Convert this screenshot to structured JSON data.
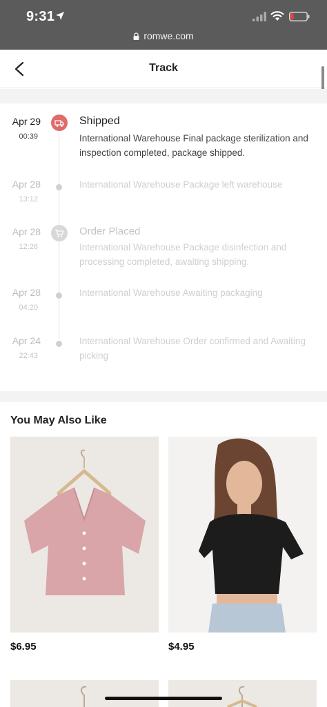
{
  "status_bar": {
    "time": "9:31",
    "url": "romwe.com"
  },
  "header": {
    "title": "Track"
  },
  "timeline": [
    {
      "date": "Apr 29",
      "time": "00:39",
      "status": "Shipped",
      "description": "International Warehouse Final package sterilization and inspection completed, package shipped.",
      "active": true,
      "icon": "truck-icon"
    },
    {
      "date": "Apr 28",
      "time": "13:12",
      "status": "",
      "description": "International Warehouse Package left warehouse",
      "active": false,
      "icon": "dot"
    },
    {
      "date": "Apr 28",
      "time": "12:26",
      "status": "Order Placed",
      "description": "International Warehouse Package disinfection and processing completed, awaiting shipping.",
      "active": false,
      "icon": "cart-icon"
    },
    {
      "date": "Apr 28",
      "time": "04:20",
      "status": "",
      "description": "International Warehouse Awaiting packaging",
      "active": false,
      "icon": "dot"
    },
    {
      "date": "Apr 24",
      "time": "22:43",
      "status": "",
      "description": "International Warehouse Order confirmed and Awaiting picking",
      "active": false,
      "icon": "dot"
    }
  ],
  "recommendations": {
    "title": "You May Also Like",
    "products": [
      {
        "price": "$6.95",
        "image": "pink-button-front-tee"
      },
      {
        "price": "$4.95",
        "image": "black-crop-tee-model"
      }
    ]
  },
  "colors": {
    "accent": "#e06b6b",
    "status_bar": "#5b5b5b",
    "divider": "#f3f3f3"
  }
}
